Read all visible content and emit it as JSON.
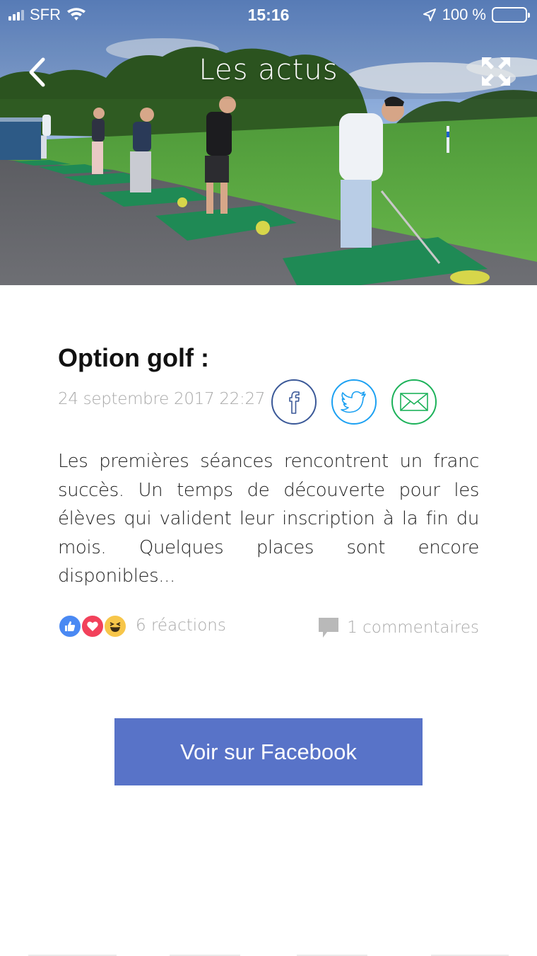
{
  "status_bar": {
    "carrier": "SFR",
    "time": "15:16",
    "battery": "100 %"
  },
  "header": {
    "title": "Les actus"
  },
  "article": {
    "title": "Option golf :",
    "date": "24 septembre 2017 22:27",
    "body": "Les premières séances rencontrent un franc succès. Un temps de découverte pour les élèves qui valident leur inscription à la fin du mois. Quelques places sont encore disponibles..."
  },
  "reactions": {
    "count_label": "6 réactions",
    "types": [
      "like-icon",
      "love-icon",
      "haha-icon"
    ]
  },
  "comments": {
    "label": "1 commentaires"
  },
  "actions": {
    "facebook_button": "Voir sur Facebook"
  },
  "colors": {
    "facebook_blue": "#3b5998",
    "twitter_blue": "#1da1f2",
    "mail_green": "#1db25a",
    "button_blue": "#5873c8"
  }
}
